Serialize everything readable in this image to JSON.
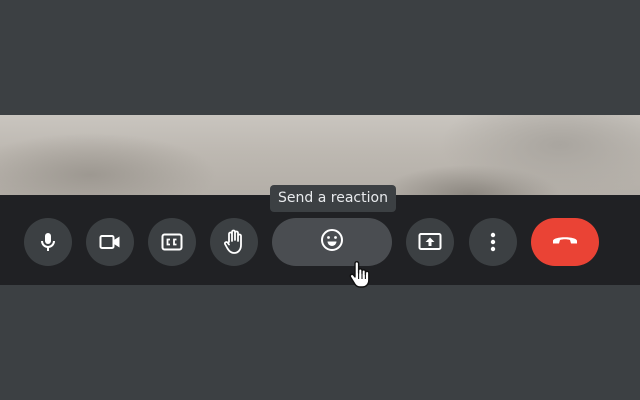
{
  "tooltip": {
    "text": "Send a reaction"
  },
  "controls": [
    {
      "id": "mic",
      "icon": "microphone-icon"
    },
    {
      "id": "camera",
      "icon": "video-camera-icon"
    },
    {
      "id": "captions",
      "icon": "closed-captions-icon"
    },
    {
      "id": "raise_hand",
      "icon": "raise-hand-icon"
    },
    {
      "id": "reaction",
      "icon": "emoji-smile-icon",
      "state": "hovered"
    },
    {
      "id": "present",
      "icon": "present-screen-icon"
    },
    {
      "id": "more",
      "icon": "more-vertical-icon"
    },
    {
      "id": "end_call",
      "icon": "end-call-icon"
    }
  ],
  "colors": {
    "background": "#3c4043",
    "bar": "#202124",
    "button": "#3c4043",
    "button_hover": "#4a4d51",
    "end_call": "#ea4335",
    "icon": "#ffffff"
  }
}
